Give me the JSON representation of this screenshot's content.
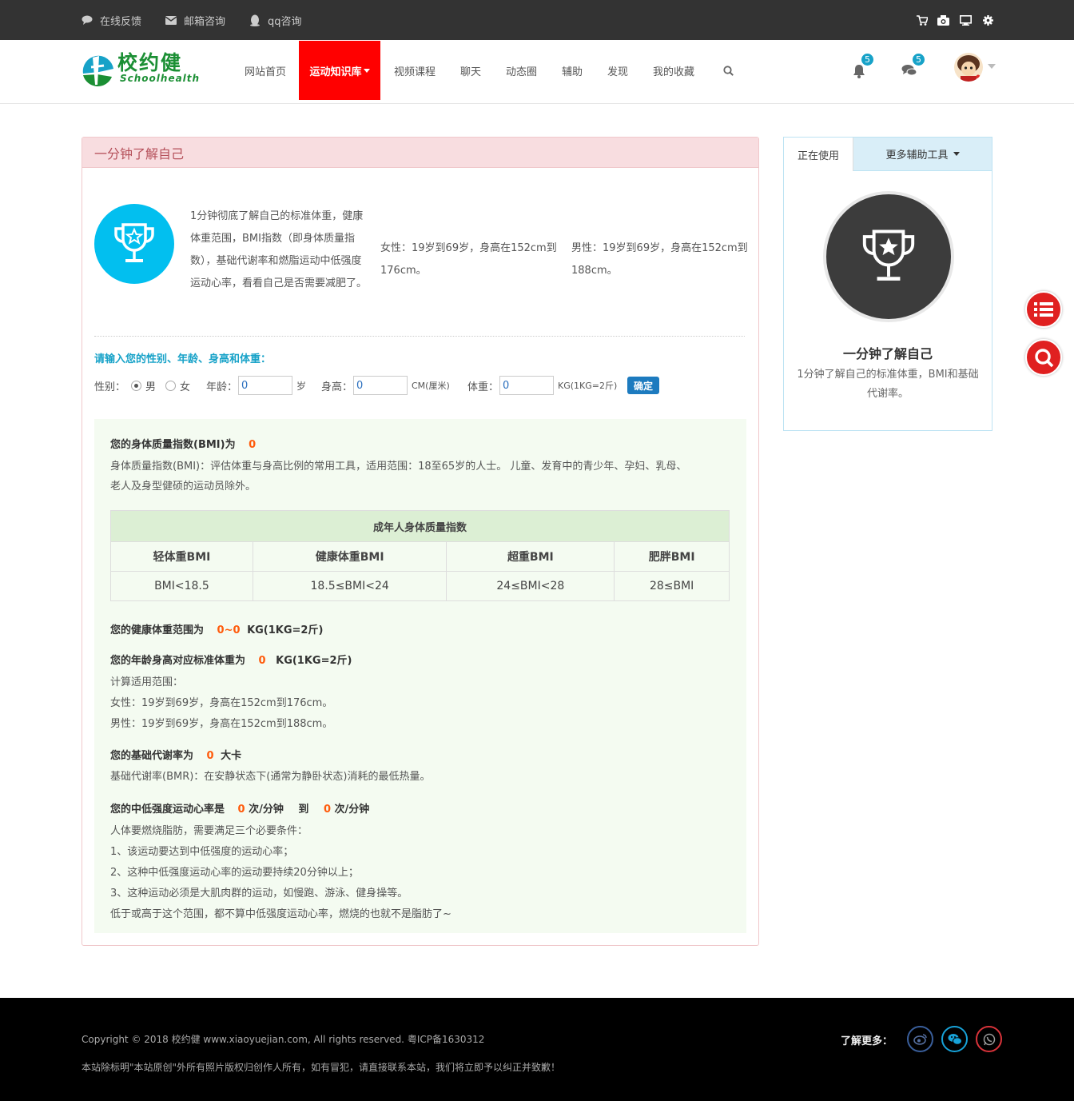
{
  "topbar": {
    "feedback": "在线反馈",
    "email": "邮箱咨询",
    "qq": "qq咨询"
  },
  "logo": {
    "cn": "校约健",
    "en": "Schoolhealth"
  },
  "menu": [
    "网站首页",
    "运动知识库",
    "视频课程",
    "聊天",
    "动态圈",
    "辅助",
    "发现",
    "我的收藏"
  ],
  "notifications": {
    "bell_count": "5",
    "chat_count": "5"
  },
  "panel": {
    "title": "一分钟了解自己",
    "intro": "1分钟彻底了解自己的标准体重，健康体重范围，BMI指数（即身体质量指数），基础代谢率和燃脂运动中低强度运动心率，看看自己是否需要减肥了。",
    "female_range": "女性：19岁到69岁，身高在152cm到176cm。",
    "male_range": "男性：19岁到69岁，身高在152cm到188cm。",
    "prompt": "请输入您的性别、年龄、身高和体重：",
    "form": {
      "gender_label": "性别：",
      "male": "男",
      "female": "女",
      "age_label": "年龄：",
      "age_value": "0",
      "age_unit": "岁",
      "height_label": "身高：",
      "height_value": "0",
      "height_unit": "CM(厘米)",
      "weight_label": "体重：",
      "weight_value": "0",
      "weight_unit": "KG(1KG=2斤)",
      "submit": "确定"
    }
  },
  "result": {
    "bmi_title": "您的身体质量指数(BMI)为",
    "bmi_value": "0",
    "bmi_desc_1": "身体质量指数(BMI)：评估体重与身高比例的常用工具，适用范围：18至65岁的人士。 儿童、发育中的青少年、孕妇、乳母、",
    "bmi_desc_2": "老人及身型健硕的运动员除外。",
    "table": {
      "caption": "成年人身体质量指数",
      "headers": [
        "轻体重BMI",
        "健康体重BMI",
        "超重BMI",
        "肥胖BMI"
      ],
      "values": [
        "BMI<18.5",
        "18.5≤BMI<24",
        "24≤BMI<28",
        "28≤BMI"
      ]
    },
    "healthy_title": "您的健康体重范围为",
    "healthy_value": "0~0",
    "healthy_unit": "KG(1KG=2斤)",
    "standard_title": "您的年龄身高对应标准体重为",
    "standard_value": "0",
    "standard_unit": "KG(1KG=2斤)",
    "calc_scope": "计算适用范围：",
    "calc_female": "女性：19岁到69岁，身高在152cm到176cm。",
    "calc_male": "男性：19岁到69岁，身高在152cm到188cm。",
    "bmr_title": "您的基础代谢率为",
    "bmr_value": "0",
    "bmr_unit": "大卡",
    "bmr_desc": "基础代谢率(BMR)：在安静状态下(通常为静卧状态)消耗的最低热量。",
    "hr_title": "您的中低强度运动心率是",
    "hr_low": "0",
    "hr_unit_1": "次/分钟",
    "hr_to": "到",
    "hr_high": "0",
    "hr_unit_2": "次/分钟",
    "fat_lines": [
      "人体要燃烧脂肪，需要满足三个必要条件：",
      "1、该运动要达到中低强度的运动心率；",
      "2、这种中低强度运动心率的运动要持续20分钟以上；",
      "3、这种运动必须是大肌肉群的运动，如慢跑、游泳、健身操等。",
      "低于或高于这个范围，都不算中低强度运动心率，燃烧的也就不是脂肪了~"
    ]
  },
  "sidebar": {
    "tab_active": "正在使用",
    "tab_more": "更多辅助工具",
    "title": "一分钟了解自己",
    "desc": "1分钟了解自己的标准体重，BMI和基础代谢率。"
  },
  "footer": {
    "copyright": "Copyright © 2018 校约健 www.xiaoyuejian.com, All rights reserved. 粤ICP备1630312",
    "notice": "本站除标明\"本站原创\"外所有照片版权归创作人所有，如有冒犯，请直接联系本站，我们将立即予以纠正并致歉！",
    "more": "了解更多："
  },
  "colors": {
    "accent": "#ff0000",
    "cyan": "#02bfef",
    "teal": "#17a2c8",
    "orange": "#ff5b0c",
    "result_bg": "#f4fbf1"
  }
}
